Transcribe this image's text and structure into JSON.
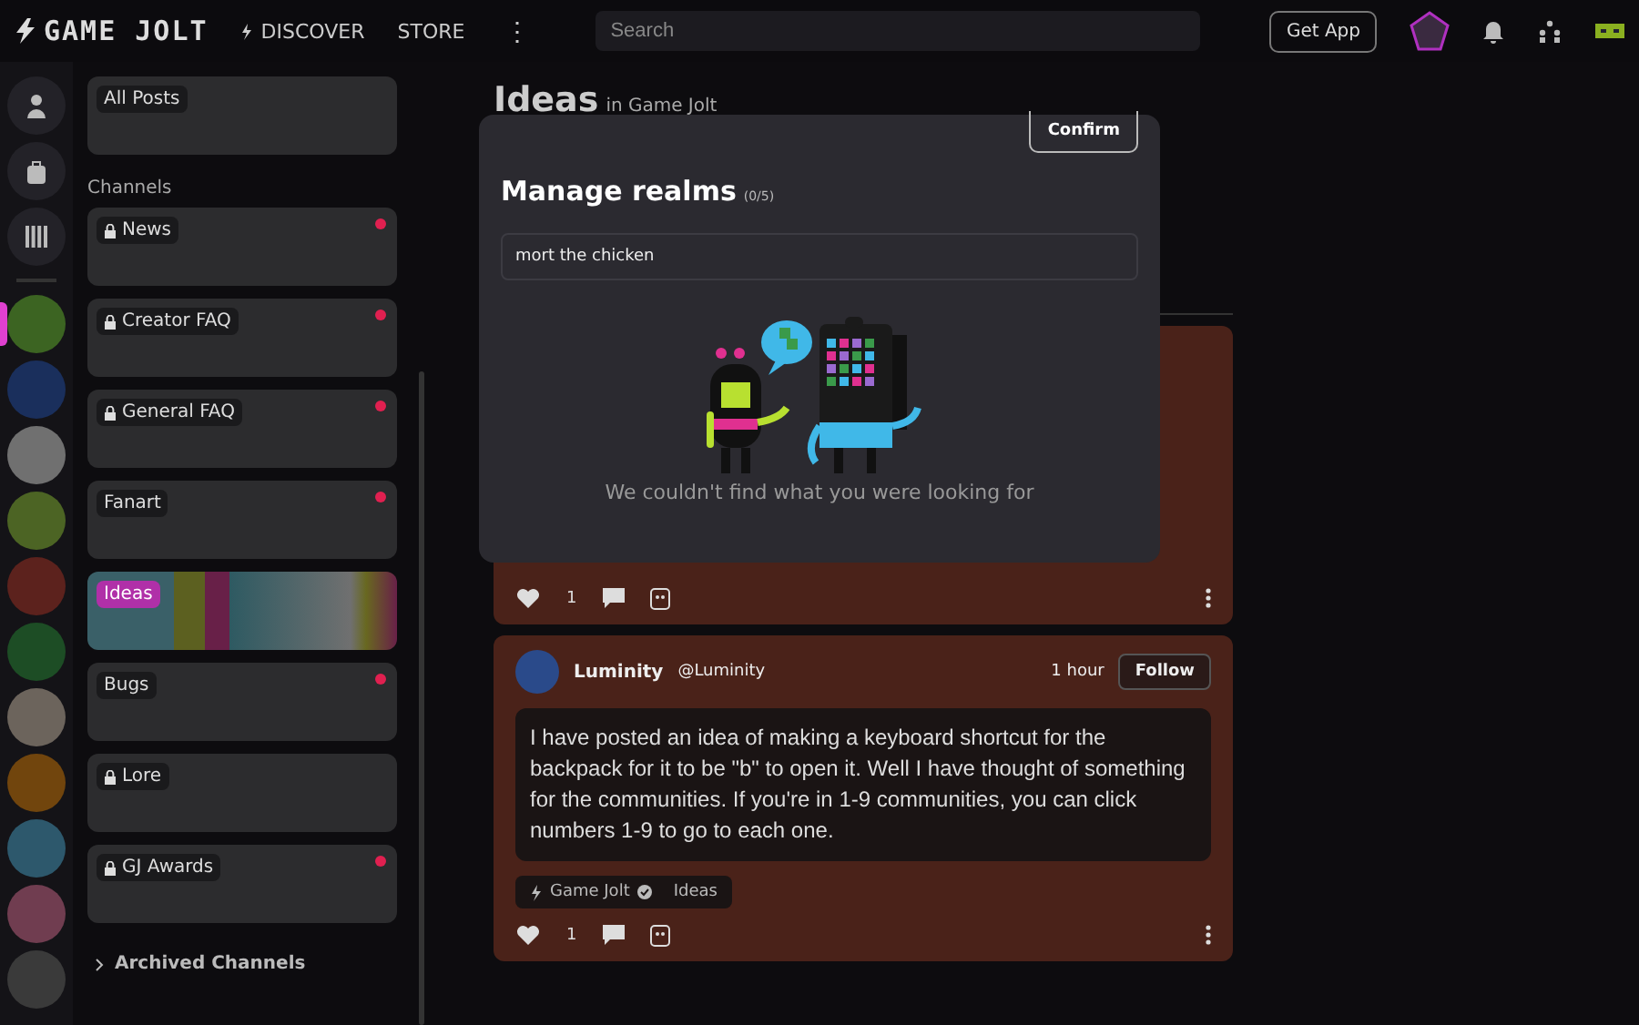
{
  "top_bar": {
    "logo": "GAME JOLT",
    "nav": [
      {
        "label": "DISCOVER",
        "kind": "icon"
      },
      {
        "label": "STORE",
        "kind": "plain"
      }
    ],
    "more": "⋮",
    "search": {
      "placeholder": "Search"
    },
    "get_app": "Get App"
  },
  "rail": {
    "communities": [
      {
        "color": "#3c6422",
        "selected": true
      },
      {
        "color": "#1a2f5c",
        "selected": false
      },
      {
        "color": "#707070",
        "selected": false
      },
      {
        "color": "#4c6424",
        "selected": false
      },
      {
        "color": "#5c221d",
        "selected": false
      },
      {
        "color": "#1d4d25",
        "selected": false
      },
      {
        "color": "#6c645c",
        "selected": false
      },
      {
        "color": "#71450d",
        "selected": false
      },
      {
        "color": "#2d586c",
        "selected": false
      },
      {
        "color": "#703d50",
        "selected": false
      },
      {
        "color": "#3a3a3a",
        "selected": false
      }
    ]
  },
  "channels_panel": {
    "all_posts": "All Posts",
    "heading": "Channels",
    "channels": [
      {
        "name": "News",
        "locked": true,
        "unread": true,
        "selected": false
      },
      {
        "name": "Creator FAQ",
        "locked": true,
        "unread": true,
        "selected": false
      },
      {
        "name": "General FAQ",
        "locked": true,
        "unread": true,
        "selected": false
      },
      {
        "name": "Fanart",
        "locked": false,
        "unread": true,
        "selected": false
      },
      {
        "name": "Ideas",
        "locked": false,
        "unread": false,
        "selected": true
      },
      {
        "name": "Bugs",
        "locked": false,
        "unread": true,
        "selected": false
      },
      {
        "name": "Lore",
        "locked": true,
        "unread": false,
        "selected": false
      },
      {
        "name": "GJ Awards",
        "locked": true,
        "unread": true,
        "selected": false
      }
    ],
    "archived": "Archived Channels"
  },
  "feed": {
    "title": "Ideas",
    "subtitle": "in Game Jolt",
    "posts": [
      {
        "kind": "covered",
        "likes": "1"
      },
      {
        "kind": "full",
        "author": "Luminity",
        "handle": "@Luminity",
        "time": "1 hour",
        "follow": "Follow",
        "body": "I have posted an idea of making a keyboard shortcut for the backpack for it to be \"b\" to open it. Well I have thought of something for the communities. If you're in 1-9 communities, you can click numbers 1-9 to go to each one.",
        "tags": [
          {
            "label": "Game Jolt",
            "kind": "community"
          },
          {
            "label": "Ideas",
            "kind": "channel"
          }
        ],
        "likes": "1"
      }
    ]
  },
  "modal": {
    "confirm": "Confirm",
    "title": "Manage realms",
    "count": "(0/5)",
    "search_value": "mort the chicken",
    "empty_message": "We couldn't find what you were looking for"
  }
}
